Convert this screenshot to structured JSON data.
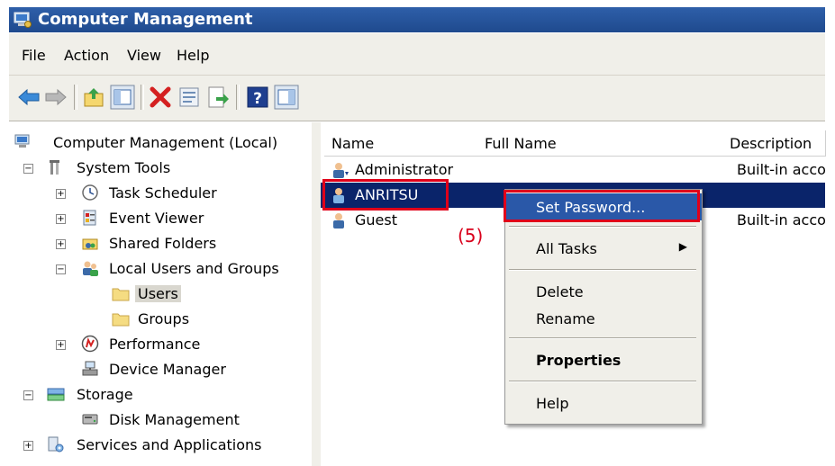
{
  "window": {
    "title": "Computer Management"
  },
  "menu": [
    "File",
    "Action",
    "View",
    "Help"
  ],
  "toolbar": {
    "buttons": [
      "back-icon",
      "forward-icon",
      "up-folder-icon",
      "show-hide-tree-icon",
      "delete-icon",
      "properties-icon",
      "export-list-icon",
      "help-icon",
      "show-hide-action-pane-icon"
    ]
  },
  "tree": {
    "root": "Computer Management (Local)",
    "system_tools": "System Tools",
    "task_scheduler": "Task Scheduler",
    "event_viewer": "Event Viewer",
    "shared_folders": "Shared Folders",
    "local_users_groups": "Local Users and Groups",
    "users": "Users",
    "groups": "Groups",
    "performance": "Performance",
    "device_manager": "Device Manager",
    "storage": "Storage",
    "disk_management": "Disk Management",
    "services_apps": "Services and Applications",
    "selected": "Users"
  },
  "list": {
    "columns": [
      "Name",
      "Full Name",
      "Description"
    ],
    "rows": [
      {
        "name": "Administrator",
        "full_name": "",
        "description": "Built-in acco"
      },
      {
        "name": "ANRITSU",
        "full_name": "",
        "description": ""
      },
      {
        "name": "Guest",
        "full_name": "",
        "description": "Built-in acco"
      }
    ],
    "selected_row": "ANRITSU"
  },
  "callout": "(5)",
  "context_menu": {
    "set_password": "Set Password...",
    "all_tasks": "All Tasks",
    "delete": "Delete",
    "rename": "Rename",
    "properties": "Properties",
    "help": "Help"
  },
  "colors": {
    "highlight": "#0a246a",
    "menu_highlight": "#2a58a8",
    "annotation_red": "#e0001a"
  }
}
